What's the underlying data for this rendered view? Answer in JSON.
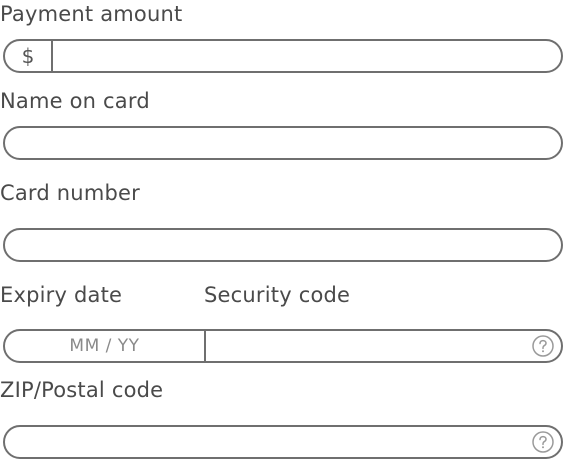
{
  "payment": {
    "label": "Payment amount",
    "currency_symbol": "$",
    "value": ""
  },
  "name_on_card": {
    "label": "Name on card",
    "value": ""
  },
  "card_number": {
    "label": "Card number",
    "value": ""
  },
  "expiry": {
    "label": "Expiry date",
    "placeholder": "MM / YY",
    "value": ""
  },
  "security_code": {
    "label": "Security code",
    "value": "",
    "help_icon": "question-circle-icon"
  },
  "zip": {
    "label": "ZIP/Postal code",
    "value": "",
    "help_icon": "question-circle-icon"
  },
  "colors": {
    "border": "#6f6f6f",
    "text": "#4a4a4a",
    "placeholder": "#8a8a8a",
    "icon": "#9a9a9a"
  }
}
